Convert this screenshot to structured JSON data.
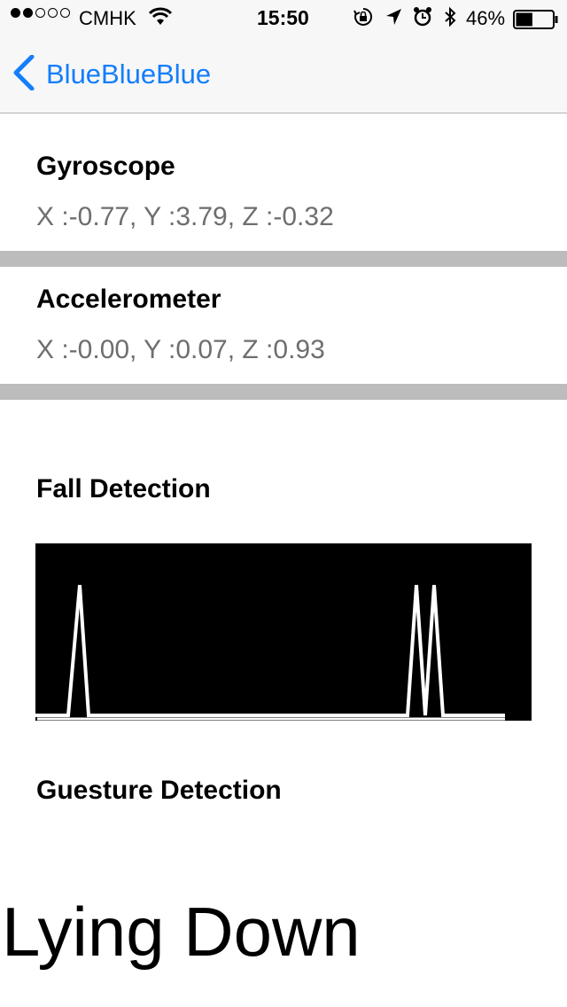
{
  "status_bar": {
    "signal_bars_filled": 2,
    "signal_bars_total": 5,
    "carrier": "CMHK",
    "time": "15:50",
    "battery_percent": "46%",
    "battery_level": 0.46,
    "icons": [
      "wifi-icon",
      "orientation-lock-icon",
      "location-arrow-icon",
      "alarm-icon",
      "bluetooth-icon",
      "battery-icon"
    ]
  },
  "nav": {
    "back_label": "BlueBlueBlue",
    "accent_color": "#147efb"
  },
  "gyroscope": {
    "title": "Gyroscope",
    "values": "X :-0.77, Y :3.79, Z :-0.32"
  },
  "accelerometer": {
    "title": "Accelerometer",
    "values": "X :-0.00, Y :0.07, Z :0.93"
  },
  "fall_detection": {
    "title": "Fall Detection"
  },
  "gesture_detection": {
    "title": "Guesture Detection",
    "status": "Lying Down"
  },
  "chart_data": {
    "type": "line",
    "title": "",
    "xlabel": "",
    "ylabel": "",
    "x": [
      0,
      37,
      50,
      60,
      420,
      430,
      440,
      450,
      460,
      530
    ],
    "y": [
      0,
      0,
      1,
      0,
      0,
      1,
      0,
      1,
      0,
      0
    ],
    "xlim": [
      0,
      530
    ],
    "ylim": [
      0,
      1
    ],
    "grid": false,
    "series": [
      {
        "color": "#ffffff"
      }
    ]
  }
}
